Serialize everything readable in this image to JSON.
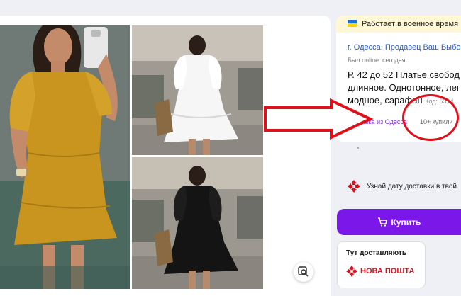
{
  "banner": {
    "text": "Работает в военное время",
    "flag_icon": "ukraine-flag-icon"
  },
  "seller": {
    "location_link": "г. Одесса. Продавец Ваш Выбор",
    "online": "Был online: сегодня"
  },
  "product": {
    "title_lines": [
      "Р. 42 до 52 Платье свобод",
      "длинное. Однотонное, лег",
      "модное, сарафан"
    ],
    "code_label": "Код: 5314",
    "delivery_text": "Доставка из Одесса",
    "bought_badge": "10+ купили"
  },
  "know_delivery": {
    "text": "Узнай дату доставки в твой"
  },
  "buy_button": {
    "label": "Купить",
    "icon": "cart-icon"
  },
  "delivery_card": {
    "label": "Тут доставляють",
    "carrier": "НОВА ПОШТА"
  },
  "colors": {
    "accent": "#7b17e8",
    "link": "#2b59c3",
    "annotation_red": "#e0101a",
    "nova_poshta_red": "#d8111d"
  }
}
